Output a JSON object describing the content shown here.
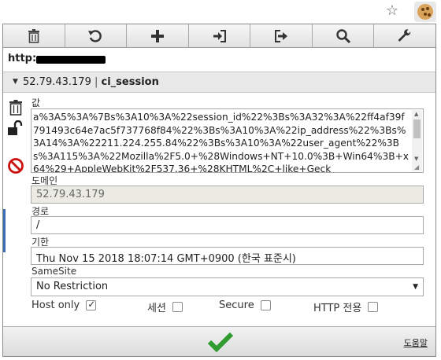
{
  "browser": {
    "star_icon": "star-icon",
    "extension_icon": "cookie-icon"
  },
  "toolbar": {
    "buttons": [
      {
        "name": "delete-all",
        "icon": "trash-icon"
      },
      {
        "name": "reset",
        "icon": "undo-icon"
      },
      {
        "name": "add",
        "icon": "plus-icon"
      },
      {
        "name": "import",
        "icon": "import-icon"
      },
      {
        "name": "export",
        "icon": "export-icon"
      },
      {
        "name": "search",
        "icon": "search-icon"
      },
      {
        "name": "options",
        "icon": "wrench-icon"
      }
    ]
  },
  "url": {
    "prefix": "http:"
  },
  "cookie": {
    "domain_header": "52.79.43.179",
    "separator": "|",
    "name": "ci_session",
    "value_label": "값",
    "value": "a%3A5%3A%7Bs%3A10%3A%22session_id%22%3Bs%3A32%3A%22ff4af39f791493c64e7ac5f737768f84%22%3Bs%3A10%3A%22ip_address%22%3Bs%3A14%3A%22211.224.255.84%22%3Bs%3A10%3A%22user_agent%22%3Bs%3A115%3A%22Mozilla%2F5.0+%28Windows+NT+10.0%3B+Win64%3B+x64%29+AppleWebKit%2F537.36+%28KHTML%2C+like+Geck",
    "domain_label": "도메인",
    "domain": "52.79.43.179",
    "path_label": "경로",
    "path": "/",
    "expiry_label": "기한",
    "expiry": "Thu Nov 15 2018 18:07:14 GMT+0900 (한국 표준시)",
    "samesite_label": "SameSite",
    "samesite": "No Restriction",
    "options": {
      "host_only_label": "Host only",
      "host_only": true,
      "session_label": "세션",
      "session": false,
      "secure_label": "Secure",
      "secure": false,
      "http_only_label": "HTTP 전용",
      "http_only": false
    }
  },
  "footer": {
    "help_label": "도움말"
  },
  "colors": {
    "check_green": "#2e9c2e",
    "block_red": "#cc1111",
    "accent_blue": "#3a6db5"
  }
}
